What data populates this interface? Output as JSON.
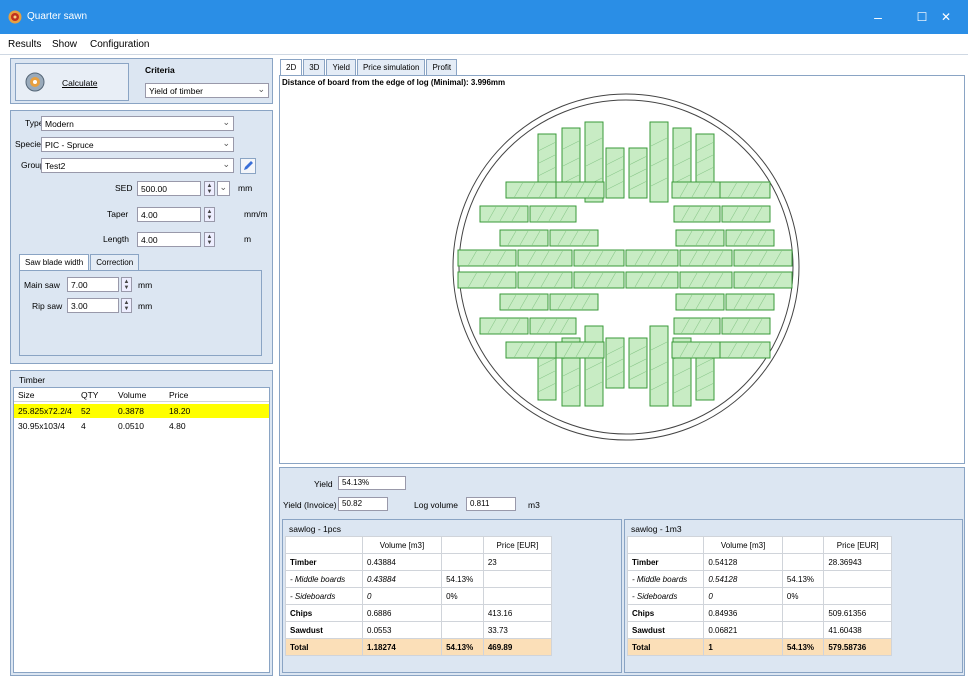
{
  "window": {
    "title": "Quarter sawn",
    "minimize": "–",
    "maximize": "☐",
    "close": "✕",
    "accent": "#2a8ee6"
  },
  "menu": {
    "results": "Results",
    "show": "Show",
    "configuration": "Configuration"
  },
  "calc": {
    "button": "Calculate",
    "criteria_label": "Criteria",
    "criteria_value": "Yield of timber"
  },
  "params": {
    "type_label": "Type",
    "type_value": "Modern",
    "species_label": "Species",
    "species_value": "PIC - Spruce",
    "group_label": "Group",
    "group_value": "Test2",
    "sed_label": "SED",
    "sed_value": "500.00",
    "sed_unit": "mm",
    "taper_label": "Taper",
    "taper_value": "4.00",
    "taper_unit": "mm/m",
    "length_label": "Length",
    "length_value": "4.00",
    "length_unit": "m"
  },
  "saw": {
    "tab1": "Saw blade width",
    "tab2": "Correction",
    "main_label": "Main saw",
    "main_value": "7.00",
    "main_unit": "mm",
    "rip_label": "Rip saw",
    "rip_value": "3.00",
    "rip_unit": "mm"
  },
  "timber": {
    "title": "Timber",
    "headers": [
      "Size",
      "QTY",
      "Volume",
      "Price"
    ],
    "rows": [
      {
        "size": "25.825x72.2/4",
        "qty": "52",
        "volume": "0.3878",
        "price": "18.20",
        "selected": true
      },
      {
        "size": "30.95x103/4",
        "qty": "4",
        "volume": "0.0510",
        "price": "4.80",
        "selected": false
      }
    ],
    "highlight_color": "#ffff00"
  },
  "view_tabs": [
    "2D",
    "3D",
    "Yield",
    "Price simulation",
    "Profit"
  ],
  "drawing": {
    "caption": "Distance of board from the edge of log (Minimal): 3.996mm",
    "board_color": "#c8ecc4"
  },
  "summary": {
    "yield_label": "Yield",
    "yield_value": "54.13%",
    "yield_invoice_label": "Yield (Invoice)",
    "yield_invoice_value": "50.82",
    "log_volume_label": "Log volume",
    "log_volume_value": "0.811",
    "log_volume_unit": "m3"
  },
  "sawlog1": {
    "title": "sawlog - 1pcs",
    "headers": [
      "",
      "Volume [m3]",
      "",
      "Price [EUR]"
    ],
    "rows": [
      [
        "Timber",
        "0.43884",
        "",
        "23"
      ],
      [
        "- Middle boards",
        "0.43884",
        "54.13%",
        ""
      ],
      [
        "- Sideboards",
        "0",
        "0%",
        ""
      ],
      [
        "Chips",
        "0.6886",
        "",
        "413.16"
      ],
      [
        "Sawdust",
        "0.0553",
        "",
        "33.73"
      ],
      [
        "Total",
        "1.18274",
        "54.13%",
        "469.89"
      ]
    ]
  },
  "sawlog2": {
    "title": "sawlog - 1m3",
    "headers": [
      "",
      "Volume [m3]",
      "",
      "Price [EUR]"
    ],
    "rows": [
      [
        "Timber",
        "0.54128",
        "",
        "28.36943"
      ],
      [
        "- Middle boards",
        "0.54128",
        "54.13%",
        ""
      ],
      [
        "- Sideboards",
        "0",
        "0%",
        ""
      ],
      [
        "Chips",
        "0.84936",
        "",
        "509.61356"
      ],
      [
        "Sawdust",
        "0.06821",
        "",
        "41.60438"
      ],
      [
        "Total",
        "1",
        "54.13%",
        "579.58736"
      ]
    ]
  }
}
